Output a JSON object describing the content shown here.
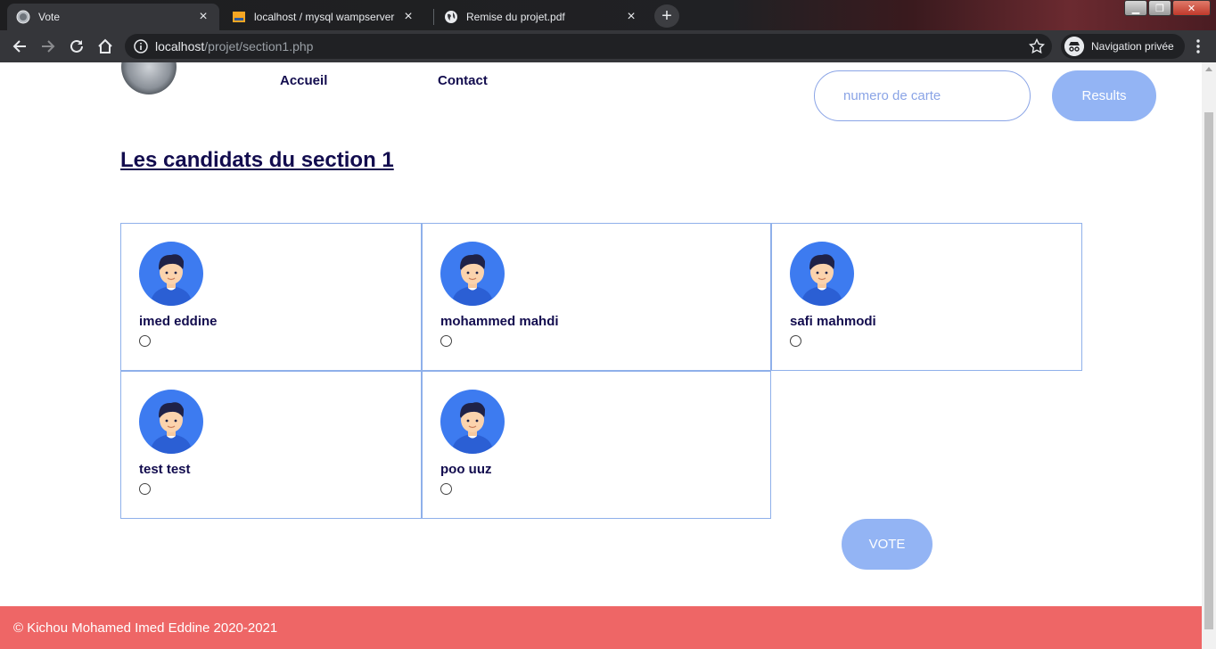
{
  "browser": {
    "tabs": [
      {
        "title": "Vote",
        "active": true,
        "favicon": "page-favicon-icon"
      },
      {
        "title": "localhost / mysql wampserver / in",
        "active": false,
        "favicon": "phpmyadmin-favicon-icon"
      },
      {
        "title": "Remise du projet.pdf",
        "active": false,
        "favicon": "globe-icon"
      }
    ],
    "new_tab_label": "+",
    "url_host": "localhost",
    "url_path": "/projet/section1.php",
    "incognito_label": "Navigation privée"
  },
  "header": {
    "nav": [
      {
        "label": "Accueil"
      },
      {
        "label": "Contact"
      }
    ],
    "search": {
      "placeholder": "numero de carte",
      "value": ""
    },
    "results_label": "Results"
  },
  "main": {
    "title": "Les candidats du section 1",
    "candidates": [
      {
        "name": "imed eddine",
        "selected": false
      },
      {
        "name": "mohammed mahdi",
        "selected": false
      },
      {
        "name": "safi mahmodi",
        "selected": false
      },
      {
        "name": "test test",
        "selected": false
      },
      {
        "name": "poo uuz",
        "selected": false
      }
    ],
    "vote_label": "VOTE"
  },
  "footer": {
    "text": "© Kichou Mohamed Imed Eddine 2020-2021"
  },
  "colors": {
    "accent": "#93b4f4",
    "heading": "#120c4e",
    "footer": "#ee6666",
    "card_border": "#8fb0ea"
  }
}
